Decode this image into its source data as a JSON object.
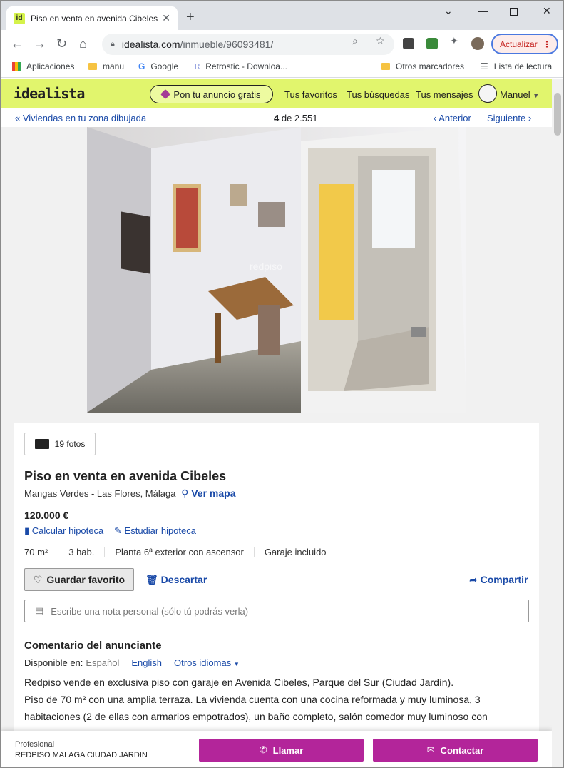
{
  "browser": {
    "tab_title": "Piso en venta en avenida Cibeles",
    "favicon_text": "id",
    "url_host": "idealista.com",
    "url_path": "/inmueble/96093481/",
    "update_label": "Actualizar",
    "bookmarks": [
      "Aplicaciones",
      "manu",
      "Google",
      "Retrostic - Downloa...",
      "Otros marcadores",
      "Lista de lectura"
    ]
  },
  "site": {
    "logo": "idealista",
    "ad_button": "Pon tu anuncio gratis",
    "nav": [
      "Tus favoritos",
      "Tus búsquedas",
      "Tus mensajes"
    ],
    "user": "Manuel"
  },
  "subnav": {
    "back_label": "Viviendas en tu zona dibujada",
    "position_current": "4",
    "position_of": "de 2.551",
    "prev_label": "Anterior",
    "next_label": "Siguiente"
  },
  "photo": {
    "watermark": "redpiso"
  },
  "listing": {
    "photos_count": "19 fotos",
    "title": "Piso en venta en avenida Cibeles",
    "location": "Mangas Verdes - Las Flores, Málaga",
    "map_link": "Ver mapa",
    "price": "120.000 €",
    "calc_mortgage": "Calcular hipoteca",
    "study_mortgage": "Estudiar hipoteca",
    "features": [
      "70 m²",
      "3 hab.",
      "Planta 6ª exterior con ascensor",
      "Garaje incluido"
    ],
    "save_label": "Guardar favorito",
    "discard_label": "Descartar",
    "share_label": "Compartir",
    "note_placeholder": "Escribe una nota personal (sólo tú podrás verla)",
    "comment_heading": "Comentario del anunciante",
    "available_in": "Disponible en:",
    "languages": [
      "Español",
      "English",
      "Otros idiomas"
    ],
    "description_line1": "Redpiso vende en exclusiva piso con garaje en Avenida Cibeles, Parque del Sur (Ciudad Jardín).",
    "description_line2": "Piso de 70 m² con una amplia terraza. La vivienda cuenta con una cocina reformada y muy luminosa, 3 habitaciones (2 de ellas con armarios empotrados), un baño completo, salón comedor muy luminoso con"
  },
  "contact_bar": {
    "type": "Profesional",
    "agency": "REDPISO MALAGA CIUDAD JARDIN",
    "call_label": "Llamar",
    "contact_label": "Contactar"
  },
  "colors": {
    "brand_yellow": "#e1f56d",
    "link_blue": "#1a4aa8",
    "cta_magenta": "#b3259a"
  }
}
